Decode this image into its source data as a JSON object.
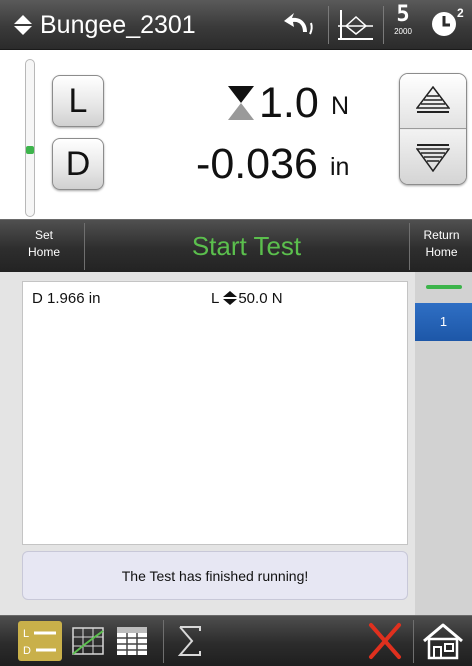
{
  "header": {
    "title": "Bungee_2301",
    "icons": [
      "diamond-icon",
      "undo-icon",
      "fixture-icon",
      "load-cell-icon",
      "clock-icon"
    ],
    "load_cell_value": "5",
    "load_cell_capacity": "2000",
    "clock_superscript": "2"
  },
  "readouts": {
    "load_button": "L",
    "displacement_button": "D",
    "load_value": "1.0",
    "load_unit": "N",
    "displacement_value": "-0.036",
    "displacement_unit": "in"
  },
  "actions": {
    "set_home_line1": "Set",
    "set_home_line2": "Home",
    "start_test": "Start Test",
    "return_home_line1": "Return",
    "return_home_line2": "Home"
  },
  "results": {
    "displacement_label": "D",
    "displacement_value": "1.966",
    "displacement_unit": "in",
    "load_label": "L",
    "load_value": "50.0",
    "load_unit": "N",
    "status_message": "The Test has finished running!"
  },
  "tabs": {
    "active_tab": "1"
  },
  "toolbar": {
    "icons": [
      "load-displacement-view-icon",
      "graph-view-icon",
      "table-view-icon",
      "sigma-statistics-icon",
      "close-x-icon",
      "home-icon"
    ]
  },
  "colors": {
    "accent_green": "#5bbf4d",
    "tab_blue": "#2f6fc4",
    "close_red": "#e0301e",
    "active_tool_gold": "#c9b04a"
  }
}
